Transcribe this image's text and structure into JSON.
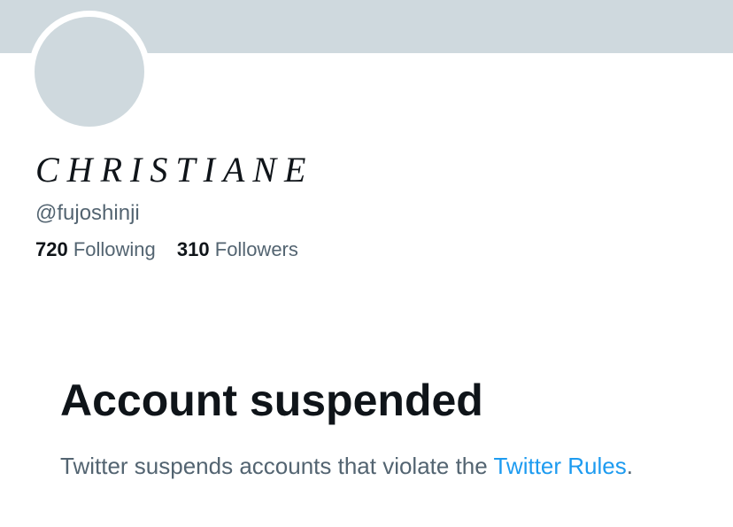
{
  "profile": {
    "display_name": "CHRISTIANE",
    "handle": "@fujoshinji",
    "following_count": "720",
    "following_label": "Following",
    "followers_count": "310",
    "followers_label": "Followers"
  },
  "suspension": {
    "title": "Account suspended",
    "message": "Twitter suspends accounts that violate the",
    "rules_link": "Twitter Rules",
    "end_punctuation": "."
  },
  "colors": {
    "banner": "#cfd9de",
    "avatar": "#cfd9de",
    "primary_text": "#0f1419",
    "secondary_text": "#536471",
    "link": "#1d9bf0"
  }
}
